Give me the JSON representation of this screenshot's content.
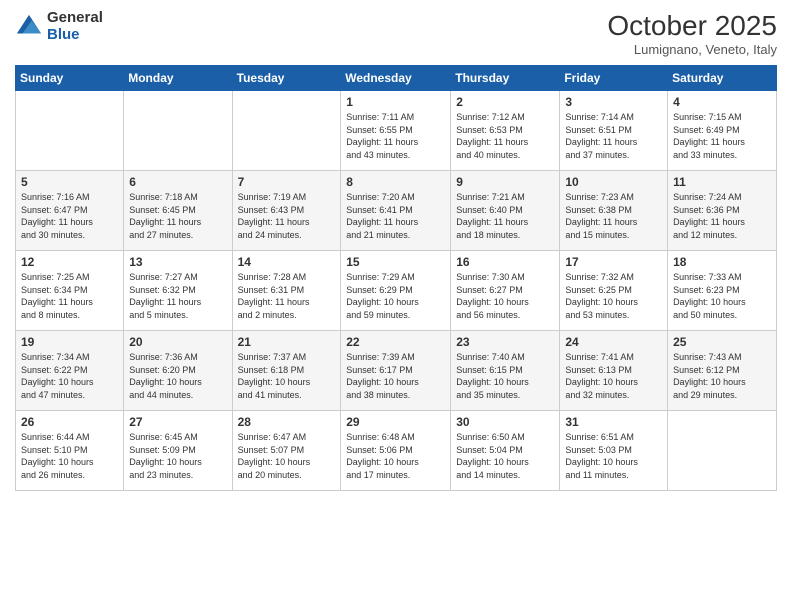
{
  "logo": {
    "general": "General",
    "blue": "Blue"
  },
  "header": {
    "month": "October 2025",
    "location": "Lumignano, Veneto, Italy"
  },
  "weekdays": [
    "Sunday",
    "Monday",
    "Tuesday",
    "Wednesday",
    "Thursday",
    "Friday",
    "Saturday"
  ],
  "weeks": [
    [
      {
        "day": "",
        "info": ""
      },
      {
        "day": "",
        "info": ""
      },
      {
        "day": "",
        "info": ""
      },
      {
        "day": "1",
        "info": "Sunrise: 7:11 AM\nSunset: 6:55 PM\nDaylight: 11 hours\nand 43 minutes."
      },
      {
        "day": "2",
        "info": "Sunrise: 7:12 AM\nSunset: 6:53 PM\nDaylight: 11 hours\nand 40 minutes."
      },
      {
        "day": "3",
        "info": "Sunrise: 7:14 AM\nSunset: 6:51 PM\nDaylight: 11 hours\nand 37 minutes."
      },
      {
        "day": "4",
        "info": "Sunrise: 7:15 AM\nSunset: 6:49 PM\nDaylight: 11 hours\nand 33 minutes."
      }
    ],
    [
      {
        "day": "5",
        "info": "Sunrise: 7:16 AM\nSunset: 6:47 PM\nDaylight: 11 hours\nand 30 minutes."
      },
      {
        "day": "6",
        "info": "Sunrise: 7:18 AM\nSunset: 6:45 PM\nDaylight: 11 hours\nand 27 minutes."
      },
      {
        "day": "7",
        "info": "Sunrise: 7:19 AM\nSunset: 6:43 PM\nDaylight: 11 hours\nand 24 minutes."
      },
      {
        "day": "8",
        "info": "Sunrise: 7:20 AM\nSunset: 6:41 PM\nDaylight: 11 hours\nand 21 minutes."
      },
      {
        "day": "9",
        "info": "Sunrise: 7:21 AM\nSunset: 6:40 PM\nDaylight: 11 hours\nand 18 minutes."
      },
      {
        "day": "10",
        "info": "Sunrise: 7:23 AM\nSunset: 6:38 PM\nDaylight: 11 hours\nand 15 minutes."
      },
      {
        "day": "11",
        "info": "Sunrise: 7:24 AM\nSunset: 6:36 PM\nDaylight: 11 hours\nand 12 minutes."
      }
    ],
    [
      {
        "day": "12",
        "info": "Sunrise: 7:25 AM\nSunset: 6:34 PM\nDaylight: 11 hours\nand 8 minutes."
      },
      {
        "day": "13",
        "info": "Sunrise: 7:27 AM\nSunset: 6:32 PM\nDaylight: 11 hours\nand 5 minutes."
      },
      {
        "day": "14",
        "info": "Sunrise: 7:28 AM\nSunset: 6:31 PM\nDaylight: 11 hours\nand 2 minutes."
      },
      {
        "day": "15",
        "info": "Sunrise: 7:29 AM\nSunset: 6:29 PM\nDaylight: 10 hours\nand 59 minutes."
      },
      {
        "day": "16",
        "info": "Sunrise: 7:30 AM\nSunset: 6:27 PM\nDaylight: 10 hours\nand 56 minutes."
      },
      {
        "day": "17",
        "info": "Sunrise: 7:32 AM\nSunset: 6:25 PM\nDaylight: 10 hours\nand 53 minutes."
      },
      {
        "day": "18",
        "info": "Sunrise: 7:33 AM\nSunset: 6:23 PM\nDaylight: 10 hours\nand 50 minutes."
      }
    ],
    [
      {
        "day": "19",
        "info": "Sunrise: 7:34 AM\nSunset: 6:22 PM\nDaylight: 10 hours\nand 47 minutes."
      },
      {
        "day": "20",
        "info": "Sunrise: 7:36 AM\nSunset: 6:20 PM\nDaylight: 10 hours\nand 44 minutes."
      },
      {
        "day": "21",
        "info": "Sunrise: 7:37 AM\nSunset: 6:18 PM\nDaylight: 10 hours\nand 41 minutes."
      },
      {
        "day": "22",
        "info": "Sunrise: 7:39 AM\nSunset: 6:17 PM\nDaylight: 10 hours\nand 38 minutes."
      },
      {
        "day": "23",
        "info": "Sunrise: 7:40 AM\nSunset: 6:15 PM\nDaylight: 10 hours\nand 35 minutes."
      },
      {
        "day": "24",
        "info": "Sunrise: 7:41 AM\nSunset: 6:13 PM\nDaylight: 10 hours\nand 32 minutes."
      },
      {
        "day": "25",
        "info": "Sunrise: 7:43 AM\nSunset: 6:12 PM\nDaylight: 10 hours\nand 29 minutes."
      }
    ],
    [
      {
        "day": "26",
        "info": "Sunrise: 6:44 AM\nSunset: 5:10 PM\nDaylight: 10 hours\nand 26 minutes."
      },
      {
        "day": "27",
        "info": "Sunrise: 6:45 AM\nSunset: 5:09 PM\nDaylight: 10 hours\nand 23 minutes."
      },
      {
        "day": "28",
        "info": "Sunrise: 6:47 AM\nSunset: 5:07 PM\nDaylight: 10 hours\nand 20 minutes."
      },
      {
        "day": "29",
        "info": "Sunrise: 6:48 AM\nSunset: 5:06 PM\nDaylight: 10 hours\nand 17 minutes."
      },
      {
        "day": "30",
        "info": "Sunrise: 6:50 AM\nSunset: 5:04 PM\nDaylight: 10 hours\nand 14 minutes."
      },
      {
        "day": "31",
        "info": "Sunrise: 6:51 AM\nSunset: 5:03 PM\nDaylight: 10 hours\nand 11 minutes."
      },
      {
        "day": "",
        "info": ""
      }
    ]
  ]
}
